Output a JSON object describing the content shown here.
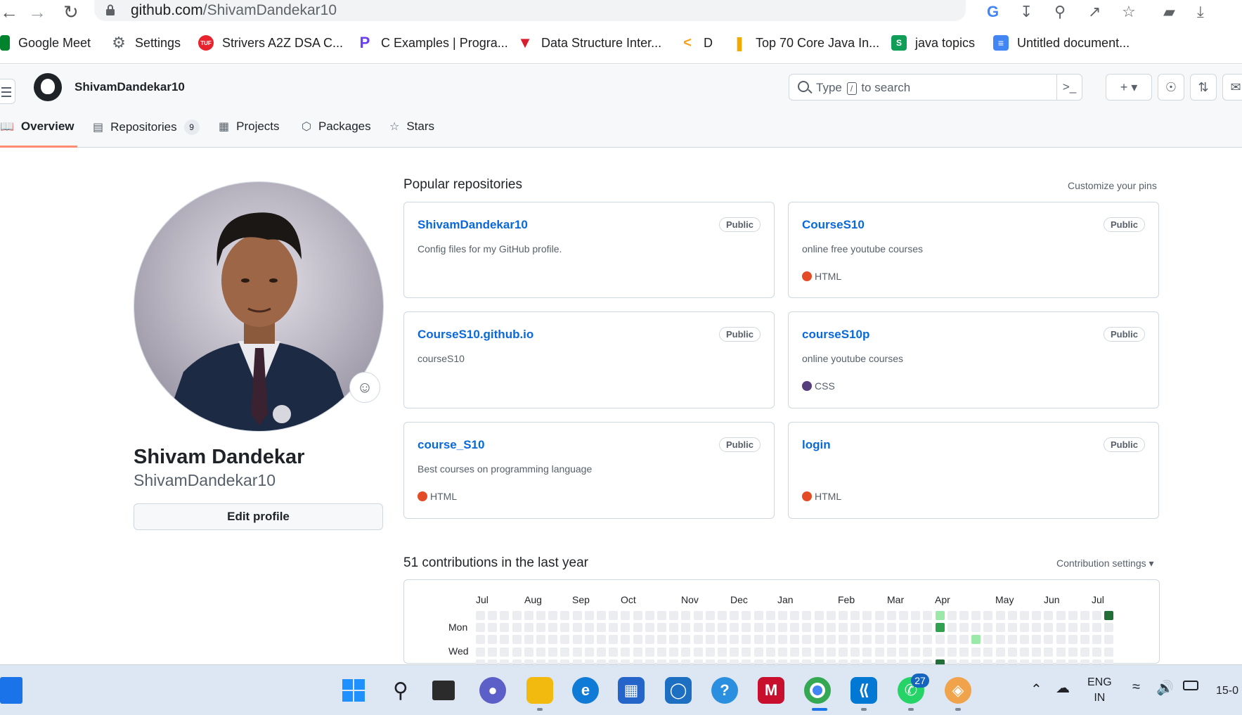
{
  "browser": {
    "url_host": "github.com",
    "url_path": "/ShivamDandekar10"
  },
  "bookmarks": [
    {
      "label": "Google Meet",
      "icon": "google-meet-icon",
      "color": "#00832d"
    },
    {
      "label": "Settings",
      "icon": "gear-icon",
      "color": "#5f6368"
    },
    {
      "label": "Strivers A2Z DSA C...",
      "icon": "tuf-icon",
      "color": "#e8232e"
    },
    {
      "label": "C Examples | Progra...",
      "icon": "programiz-icon",
      "color": "#6b3df0"
    },
    {
      "label": "Data Structure Inter...",
      "icon": "triangle-icon",
      "color": "#d91f2d"
    },
    {
      "label": "D",
      "icon": "leetcode-icon",
      "color": "#f89f1b"
    },
    {
      "label": "Top 70 Core Java In...",
      "icon": "bars-icon",
      "color": "#f2a900"
    },
    {
      "label": "java topics",
      "icon": "sheets-s-icon",
      "color": "#0f9d58"
    },
    {
      "label": "Untitled document...",
      "icon": "docs-icon",
      "color": "#4285f4"
    }
  ],
  "header": {
    "username": "ShivamDandekar10",
    "search_placeholder_pre": "Type",
    "search_key": "/",
    "search_placeholder_post": "to search"
  },
  "tabs": [
    {
      "label": "Overview",
      "icon": "book-icon"
    },
    {
      "label": "Repositories",
      "icon": "repo-icon",
      "count": "9"
    },
    {
      "label": "Projects",
      "icon": "table-icon"
    },
    {
      "label": "Packages",
      "icon": "package-icon"
    },
    {
      "label": "Stars",
      "icon": "star-icon"
    }
  ],
  "profile": {
    "name": "Shivam Dandekar",
    "login": "ShivamDandekar10",
    "edit_label": "Edit profile"
  },
  "pinned": {
    "title": "Popular repositories",
    "customize": "Customize your pins",
    "repos": [
      {
        "name": "ShivamDandekar10",
        "visibility": "Public",
        "description": "Config files for my GitHub profile.",
        "language": "",
        "lang_color": ""
      },
      {
        "name": "CourseS10",
        "visibility": "Public",
        "description": "online free youtube courses",
        "language": "HTML",
        "lang_color": "#e34c26"
      },
      {
        "name": "CourseS10.github.io",
        "visibility": "Public",
        "description": "courseS10",
        "language": "",
        "lang_color": ""
      },
      {
        "name": "courseS10p",
        "visibility": "Public",
        "description": "online youtube courses",
        "language": "CSS",
        "lang_color": "#563d7c"
      },
      {
        "name": "course_S10",
        "visibility": "Public",
        "description": "Best courses on programming language",
        "language": "HTML",
        "lang_color": "#e34c26"
      },
      {
        "name": "login",
        "visibility": "Public",
        "description": "",
        "language": "HTML",
        "lang_color": "#e34c26"
      }
    ]
  },
  "contributions": {
    "title": "51 contributions in the last year",
    "settings": "Contribution settings",
    "months": [
      "Jul",
      "Aug",
      "Sep",
      "Oct",
      "Nov",
      "Dec",
      "Jan",
      "Feb",
      "Mar",
      "Apr",
      "May",
      "Jun",
      "Jul"
    ],
    "days": [
      "Mon",
      "Wed"
    ]
  },
  "taskbar": {
    "whatsapp_badge": "27",
    "lang_top": "ENG",
    "lang_bottom": "IN",
    "clock": "15-0"
  }
}
